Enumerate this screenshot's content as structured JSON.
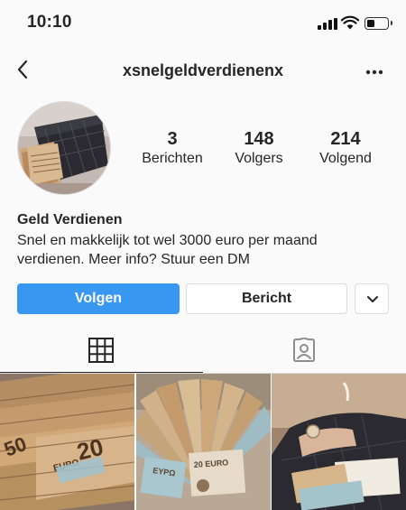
{
  "status_bar": {
    "time": "10:10",
    "signal_icon": "cellular-signal-icon",
    "wifi_icon": "wifi-icon",
    "battery_icon": "battery-icon",
    "battery_level": 0.4
  },
  "nav": {
    "back_icon": "chevron-left-icon",
    "username": "xsnelgeldverdienenx",
    "more_icon": "more-horizontal-icon"
  },
  "profile": {
    "avatar_description": "profile-photo",
    "stats": [
      {
        "value": "3",
        "label": "Berichten"
      },
      {
        "value": "148",
        "label": "Volgers"
      },
      {
        "value": "214",
        "label": "Volgend"
      }
    ],
    "name": "Geld Verdienen",
    "bio": "Snel en makkelijk tot wel 3000 euro per maand verdienen. Meer info? Stuur een DM"
  },
  "actions": {
    "follow": "Volgen",
    "message": "Bericht",
    "suggest_icon": "chevron-down-icon"
  },
  "colors": {
    "accent": "#3897f0",
    "text": "#262626",
    "border": "#dbdbdb",
    "background": "#fafafa"
  },
  "tabs": [
    {
      "icon": "grid-icon",
      "active": true
    },
    {
      "icon": "tagged-person-icon",
      "active": false
    }
  ],
  "posts": [
    {
      "description": "post-photo"
    },
    {
      "description": "post-photo"
    },
    {
      "description": "post-photo"
    }
  ]
}
